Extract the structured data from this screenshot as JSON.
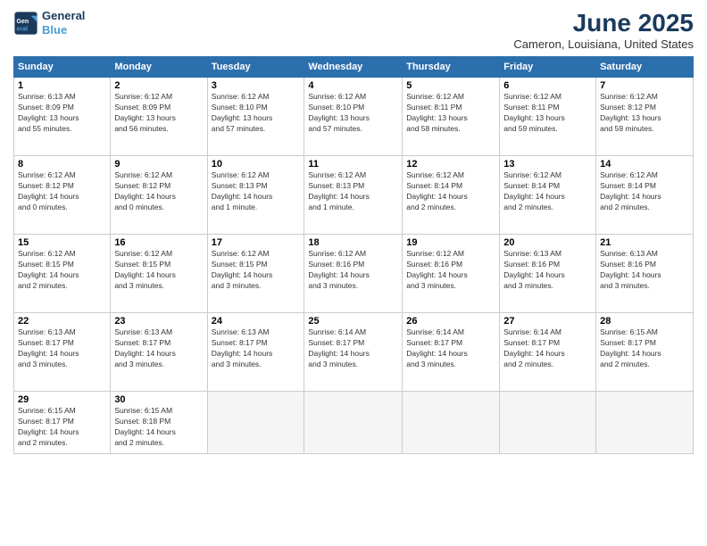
{
  "logo": {
    "line1": "General",
    "line2": "Blue"
  },
  "title": "June 2025",
  "location": "Cameron, Louisiana, United States",
  "days_header": [
    "Sunday",
    "Monday",
    "Tuesday",
    "Wednesday",
    "Thursday",
    "Friday",
    "Saturday"
  ],
  "weeks": [
    [
      {
        "day": "1",
        "info": "Sunrise: 6:13 AM\nSunset: 8:09 PM\nDaylight: 13 hours\nand 55 minutes."
      },
      {
        "day": "2",
        "info": "Sunrise: 6:12 AM\nSunset: 8:09 PM\nDaylight: 13 hours\nand 56 minutes."
      },
      {
        "day": "3",
        "info": "Sunrise: 6:12 AM\nSunset: 8:10 PM\nDaylight: 13 hours\nand 57 minutes."
      },
      {
        "day": "4",
        "info": "Sunrise: 6:12 AM\nSunset: 8:10 PM\nDaylight: 13 hours\nand 57 minutes."
      },
      {
        "day": "5",
        "info": "Sunrise: 6:12 AM\nSunset: 8:11 PM\nDaylight: 13 hours\nand 58 minutes."
      },
      {
        "day": "6",
        "info": "Sunrise: 6:12 AM\nSunset: 8:11 PM\nDaylight: 13 hours\nand 59 minutes."
      },
      {
        "day": "7",
        "info": "Sunrise: 6:12 AM\nSunset: 8:12 PM\nDaylight: 13 hours\nand 59 minutes."
      }
    ],
    [
      {
        "day": "8",
        "info": "Sunrise: 6:12 AM\nSunset: 8:12 PM\nDaylight: 14 hours\nand 0 minutes."
      },
      {
        "day": "9",
        "info": "Sunrise: 6:12 AM\nSunset: 8:12 PM\nDaylight: 14 hours\nand 0 minutes."
      },
      {
        "day": "10",
        "info": "Sunrise: 6:12 AM\nSunset: 8:13 PM\nDaylight: 14 hours\nand 1 minute."
      },
      {
        "day": "11",
        "info": "Sunrise: 6:12 AM\nSunset: 8:13 PM\nDaylight: 14 hours\nand 1 minute."
      },
      {
        "day": "12",
        "info": "Sunrise: 6:12 AM\nSunset: 8:14 PM\nDaylight: 14 hours\nand 2 minutes."
      },
      {
        "day": "13",
        "info": "Sunrise: 6:12 AM\nSunset: 8:14 PM\nDaylight: 14 hours\nand 2 minutes."
      },
      {
        "day": "14",
        "info": "Sunrise: 6:12 AM\nSunset: 8:14 PM\nDaylight: 14 hours\nand 2 minutes."
      }
    ],
    [
      {
        "day": "15",
        "info": "Sunrise: 6:12 AM\nSunset: 8:15 PM\nDaylight: 14 hours\nand 2 minutes."
      },
      {
        "day": "16",
        "info": "Sunrise: 6:12 AM\nSunset: 8:15 PM\nDaylight: 14 hours\nand 3 minutes."
      },
      {
        "day": "17",
        "info": "Sunrise: 6:12 AM\nSunset: 8:15 PM\nDaylight: 14 hours\nand 3 minutes."
      },
      {
        "day": "18",
        "info": "Sunrise: 6:12 AM\nSunset: 8:16 PM\nDaylight: 14 hours\nand 3 minutes."
      },
      {
        "day": "19",
        "info": "Sunrise: 6:12 AM\nSunset: 8:16 PM\nDaylight: 14 hours\nand 3 minutes."
      },
      {
        "day": "20",
        "info": "Sunrise: 6:13 AM\nSunset: 8:16 PM\nDaylight: 14 hours\nand 3 minutes."
      },
      {
        "day": "21",
        "info": "Sunrise: 6:13 AM\nSunset: 8:16 PM\nDaylight: 14 hours\nand 3 minutes."
      }
    ],
    [
      {
        "day": "22",
        "info": "Sunrise: 6:13 AM\nSunset: 8:17 PM\nDaylight: 14 hours\nand 3 minutes."
      },
      {
        "day": "23",
        "info": "Sunrise: 6:13 AM\nSunset: 8:17 PM\nDaylight: 14 hours\nand 3 minutes."
      },
      {
        "day": "24",
        "info": "Sunrise: 6:13 AM\nSunset: 8:17 PM\nDaylight: 14 hours\nand 3 minutes."
      },
      {
        "day": "25",
        "info": "Sunrise: 6:14 AM\nSunset: 8:17 PM\nDaylight: 14 hours\nand 3 minutes."
      },
      {
        "day": "26",
        "info": "Sunrise: 6:14 AM\nSunset: 8:17 PM\nDaylight: 14 hours\nand 3 minutes."
      },
      {
        "day": "27",
        "info": "Sunrise: 6:14 AM\nSunset: 8:17 PM\nDaylight: 14 hours\nand 2 minutes."
      },
      {
        "day": "28",
        "info": "Sunrise: 6:15 AM\nSunset: 8:17 PM\nDaylight: 14 hours\nand 2 minutes."
      }
    ],
    [
      {
        "day": "29",
        "info": "Sunrise: 6:15 AM\nSunset: 8:17 PM\nDaylight: 14 hours\nand 2 minutes."
      },
      {
        "day": "30",
        "info": "Sunrise: 6:15 AM\nSunset: 8:18 PM\nDaylight: 14 hours\nand 2 minutes."
      },
      {
        "day": "",
        "info": ""
      },
      {
        "day": "",
        "info": ""
      },
      {
        "day": "",
        "info": ""
      },
      {
        "day": "",
        "info": ""
      },
      {
        "day": "",
        "info": ""
      }
    ]
  ]
}
